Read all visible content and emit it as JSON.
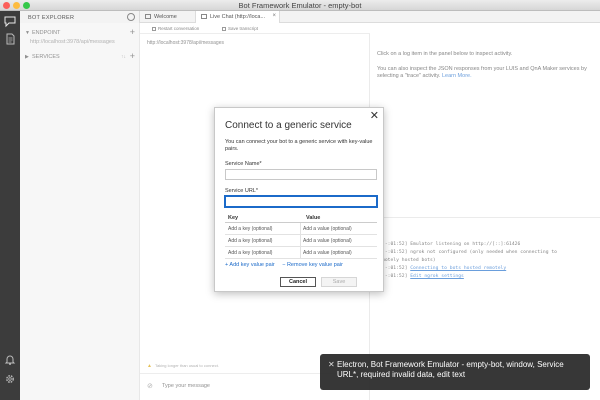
{
  "window": {
    "title": "Bot Framework Emulator - empty-bot"
  },
  "sidebar": {
    "title": "BOT EXPLORER",
    "endpoint": {
      "label": "ENDPOINT",
      "url": "http://localhost:3978/api/messages"
    },
    "services": {
      "label": "SERVICES",
      "count": "↑↓"
    }
  },
  "tabs": [
    {
      "label": "Welcome"
    },
    {
      "label": "Live Chat (http://loca..."
    }
  ],
  "chat": {
    "restart_label": "Restart conversation",
    "save_label": "Save transcript",
    "url": "http://localhost:3978/api/messages",
    "warning": "Taking longer than usual to connect.",
    "input_placeholder": "Type your message"
  },
  "inspector": {
    "line1": "Click on a log item in the panel below to inspect activity.",
    "line2": "You can also inspect the JSON responses from your LUIS and QnA Maker services by selecting a \"trace\" activity.",
    "learn_more": "Learn More."
  },
  "log": [
    {
      "time": "[-:01:52]",
      "text": "Emulator listening on http://[::]:61426",
      "link": ""
    },
    {
      "time": "[-:01:52]",
      "text": "ngrok not configured (only needed when connecting to",
      "link": ""
    },
    {
      "time": "",
      "text": "motely hosted bots)",
      "link": ""
    },
    {
      "time": "[-:01:52]",
      "text": "",
      "link": "Connecting to bots hosted remotely"
    },
    {
      "time": "[-:01:52]",
      "text": "",
      "link": "Edit ngrok settings"
    }
  ],
  "dialog": {
    "title": "Connect to a generic service",
    "description": "You can connect your bot to a generic service with key-value pairs.",
    "service_name_label": "Service Name*",
    "service_url_label": "Service URL*",
    "key_header": "Key",
    "value_header": "Value",
    "rows": [
      {
        "key": "Add a key (optional)",
        "value": "Add a value (optional)"
      },
      {
        "key": "Add a key (optional)",
        "value": "Add a value (optional)"
      },
      {
        "key": "Add a key (optional)",
        "value": "Add a value (optional)"
      }
    ],
    "add_pair": "+ Add key value pair",
    "remove_pair": "− Remove key value pair",
    "cancel_label": "Cancel",
    "save_label": "Save"
  },
  "toast": {
    "message": "Electron, Bot Framework Emulator - empty-bot, window, Service URL*, required invalid data, edit text"
  },
  "colors": {
    "accent": "#1b6ac9",
    "activity_bar": "#3c3c3c",
    "toast_bg": "#282828"
  }
}
